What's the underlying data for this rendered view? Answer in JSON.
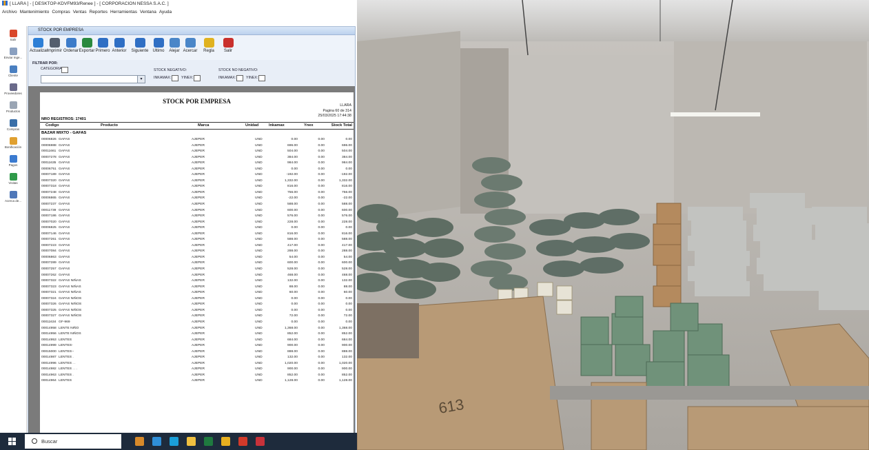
{
  "window": {
    "title": "[ LLARA ] - [ DESKTOP-KDVFM93/Renee ] - [ CORPORACION NESSA S.A.C. ]"
  },
  "menu": [
    "Archivo",
    "Mantenimiento",
    "Compras",
    "Ventas",
    "Reportes",
    "Herramientas",
    "Ventana",
    "Ayuda"
  ],
  "nav": [
    {
      "label": "Salir",
      "color": "#d9482b"
    },
    {
      "label": "Enviar Inge...",
      "color": "#8aa0c0"
    },
    {
      "label": "Cliente",
      "color": "#4a7fc0"
    },
    {
      "label": "Proveedores",
      "color": "#6a6a8a"
    },
    {
      "label": "Productos",
      "color": "#9aa5b4"
    },
    {
      "label": "Compras",
      "color": "#3a6fa8"
    },
    {
      "label": "Bonificación",
      "color": "#e0a030"
    },
    {
      "label": "Pagos",
      "color": "#3b7bd0"
    },
    {
      "label": "Visitas",
      "color": "#2f9a4a"
    },
    {
      "label": "Acerca de...",
      "color": "#4f77b8"
    }
  ],
  "child_window": {
    "title": "STOCK POR EMPRESA"
  },
  "toolbar": [
    {
      "label": "Actualizar",
      "icon": "refresh-icon",
      "color": "#2d7fd6"
    },
    {
      "label": "Imprimir",
      "icon": "printer-icon",
      "color": "#555f6e"
    },
    {
      "label": "Ordenar",
      "icon": "sort-icon",
      "color": "#3d7cc9"
    },
    {
      "label": "Exportar",
      "icon": "excel-icon",
      "color": "#2a8a3f"
    },
    {
      "label": "Primero",
      "icon": "first-icon",
      "color": "#2f6fc4"
    },
    {
      "label": "Anterior",
      "icon": "prev-icon",
      "color": "#2f6fc4"
    },
    {
      "label": "Siguiente",
      "icon": "next-icon",
      "color": "#2f6fc4"
    },
    {
      "label": "Ultimo",
      "icon": "last-icon",
      "color": "#2f6fc4"
    },
    {
      "label": "Alejar",
      "icon": "zoom-out-icon",
      "color": "#4a86c8"
    },
    {
      "label": "Acercar",
      "icon": "zoom-in-icon",
      "color": "#4a86c8"
    },
    {
      "label": "Regla",
      "icon": "ruler-icon",
      "color": "#e0b21f"
    },
    {
      "label": "Salir",
      "icon": "exit-icon",
      "color": "#c9302c"
    }
  ],
  "filter": {
    "heading": "FILTRAR POR:",
    "categoria_label": "CATEGORIA:",
    "neg_heading": "STOCK NEGATIVO:",
    "noneg_heading": "STOCK NO NEGATIVO:",
    "inkamax": "INKAMAX:",
    "ynex": "YINEX:"
  },
  "report": {
    "title": "STOCK POR EMPRESA",
    "app": "LLARA",
    "page": "Pagina 60 de 314",
    "datetime": "25/03/2025 17:44:38",
    "nro_registros": "NRO REGISTROS: 17401",
    "headers": {
      "codigo": "Codigo",
      "producto": "Producto",
      "marca": "Marca",
      "unidad": "Unidad",
      "inkamax": "Inkamax",
      "ynex": "Ynex",
      "total": "Stock Total"
    },
    "group": "BAZAR MIXTO - GAFAS",
    "rows": [
      [
        "00006826",
        "GAFAS",
        "AJEPER",
        "UND",
        "0.00",
        "0.00",
        "0.00"
      ],
      [
        "00006988",
        "GAFAS",
        "AJEPER",
        "UND",
        "696.00",
        "0.00",
        "696.00"
      ],
      [
        "00011661",
        "GAFAS",
        "AJEPER",
        "UND",
        "504.00",
        "0.00",
        "504.00"
      ],
      [
        "00007278",
        "GAFAS",
        "AJEPER",
        "UND",
        "384.00",
        "0.00",
        "384.00"
      ],
      [
        "00011635",
        "GAFAS",
        "AJEPER",
        "UND",
        "984.00",
        "0.00",
        "984.00"
      ],
      [
        "00006751",
        "GAFAS",
        "AJEPER",
        "UND",
        "0.00",
        "0.00",
        "0.00"
      ],
      [
        "00007189",
        "GAFAS",
        "AJEPER",
        "UND",
        "-192.00",
        "0.00",
        "-192.00"
      ],
      [
        "00007320",
        "GAFAS",
        "AJEPER",
        "UND",
        "1,332.00",
        "0.00",
        "1,332.00"
      ],
      [
        "00007318",
        "GAFAS",
        "AJEPER",
        "UND",
        "816.00",
        "0.00",
        "816.00"
      ],
      [
        "00007248",
        "GAFAS",
        "AJEPER",
        "UND",
        "756.00",
        "0.00",
        "756.00"
      ],
      [
        "00006865",
        "GAFAS",
        "AJEPER",
        "UND",
        "-22.00",
        "0.00",
        "-22.00"
      ],
      [
        "00007237",
        "GAFAS",
        "AJEPER",
        "UND",
        "588.00",
        "0.00",
        "588.00"
      ],
      [
        "00011739",
        "GAFAS",
        "AJEPER",
        "UND",
        "600.00",
        "0.00",
        "600.00"
      ],
      [
        "00007186",
        "GAFAS",
        "AJEPER",
        "UND",
        "576.00",
        "0.00",
        "576.00"
      ],
      [
        "00007020",
        "GAFAS",
        "AJEPER",
        "UND",
        "228.00",
        "0.00",
        "228.00"
      ],
      [
        "00006825",
        "GAFAS",
        "AJEPER",
        "UND",
        "0.00",
        "0.00",
        "0.00"
      ],
      [
        "00007146",
        "GAFAS",
        "AJEPER",
        "UND",
        "816.00",
        "0.00",
        "816.00"
      ],
      [
        "00007261",
        "GAFAS",
        "AJEPER",
        "UND",
        "588.00",
        "0.00",
        "588.00"
      ],
      [
        "00007223",
        "GAFAS",
        "AJEPER",
        "UND",
        "417.00",
        "0.00",
        "417.00"
      ],
      [
        "00007084",
        "GAFAS",
        "AJEPER",
        "UND",
        "288.00",
        "0.00",
        "288.00"
      ],
      [
        "00006863",
        "GAFAS",
        "AJEPER",
        "UND",
        "54.00",
        "0.00",
        "54.00"
      ],
      [
        "00007289",
        "GAFAS",
        "AJEPER",
        "UND",
        "600.00",
        "0.00",
        "600.00"
      ],
      [
        "00007257",
        "GAFAS",
        "AJEPER",
        "UND",
        "528.00",
        "0.00",
        "528.00"
      ],
      [
        "00007262",
        "GAFAS",
        "AJEPER",
        "UND",
        "468.00",
        "0.00",
        "468.00"
      ],
      [
        "00007322",
        "GAFAS NIÑAS",
        "AJEPER",
        "UND",
        "132.00",
        "0.00",
        "132.00"
      ],
      [
        "00007323",
        "GAFAS NIÑAS",
        "AJEPER",
        "UND",
        "88.00",
        "0.00",
        "88.00"
      ],
      [
        "00007321",
        "GAFAS NIÑAS",
        "AJEPER",
        "UND",
        "60.00",
        "0.00",
        "60.00"
      ],
      [
        "00007324",
        "GAFAS NIÑOS",
        "AJEPER",
        "UND",
        "0.00",
        "0.00",
        "0.00"
      ],
      [
        "00007326",
        "GAFAS NIÑOS",
        "AJEPER",
        "UND",
        "0.00",
        "0.00",
        "0.00"
      ],
      [
        "00007325",
        "GAFAS NIÑOS",
        "AJEPER",
        "UND",
        "0.00",
        "0.00",
        "0.00"
      ],
      [
        "00007327",
        "GAFAS NIÑOS",
        "AJEPER",
        "UND",
        "72.00",
        "0.00",
        "72.00"
      ],
      [
        "00011634",
        "GF-969",
        "AJEPER",
        "UND",
        "0.00",
        "0.00",
        "0.00"
      ],
      [
        "00014958",
        "LENTE NIÑO",
        "AJEPER",
        "UND",
        "1,368.00",
        "0.00",
        "1,368.00"
      ],
      [
        "00014956",
        "LENTE NIÑOS",
        "AJEPER",
        "UND",
        "852.00",
        "0.00",
        "852.00"
      ],
      [
        "00014953",
        "LENTES",
        "AJEPER",
        "UND",
        "684.00",
        "0.00",
        "684.00"
      ],
      [
        "00014999",
        "LENTES-",
        "AJEPER",
        "UND",
        "900.00",
        "0.00",
        "900.00"
      ],
      [
        "00015000",
        "LENTES--",
        "AJEPER",
        "UND",
        "888.00",
        "0.00",
        "888.00"
      ],
      [
        "00014987",
        "LENTES .",
        "AJEPER",
        "UND",
        "132.00",
        "0.00",
        "132.00"
      ],
      [
        "00014996",
        "LENTES . .",
        "AJEPER",
        "UND",
        "1,020.00",
        "0.00",
        "1,020.00"
      ],
      [
        "00014982",
        "LENTES . . .",
        "AJEPER",
        "UND",
        "900.00",
        "0.00",
        "900.00"
      ],
      [
        "00014963",
        "LENTES .",
        "AJEPER",
        "UND",
        "852.00",
        "0.00",
        "852.00"
      ],
      [
        "00014964",
        "LENTES",
        "AJEPER",
        "UND",
        "1,128.00",
        "0.00",
        "1,128.00"
      ]
    ]
  },
  "taskbar": {
    "search_placeholder": "Buscar",
    "apps": [
      {
        "icon": "app-icon",
        "color": "#d88a2a"
      },
      {
        "icon": "app-icon",
        "color": "#2f8fd8"
      },
      {
        "icon": "app-icon",
        "color": "#1a9fd9"
      },
      {
        "icon": "folder-icon",
        "color": "#f0c040"
      },
      {
        "icon": "excel-icon",
        "color": "#1f7a3f"
      },
      {
        "icon": "chrome-icon",
        "color": "#e8b020"
      },
      {
        "icon": "app-icon",
        "color": "#d23a2a"
      },
      {
        "icon": "app-icon",
        "color": "#c8323a"
      }
    ]
  }
}
